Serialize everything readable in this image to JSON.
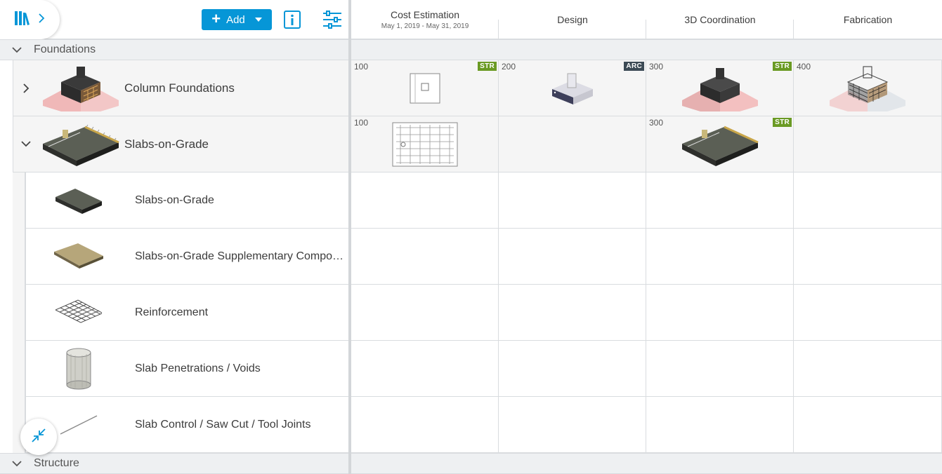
{
  "toolbar": {
    "library_icon": "library-books-icon",
    "add_label": "Add",
    "info_icon": "info-icon",
    "filter_icon": "sliders-icon"
  },
  "groups": {
    "foundations": "Foundations",
    "structure": "Structure"
  },
  "rows": {
    "column_foundations": "Column Foundations",
    "slabs_on_grade": "Slabs-on-Grade"
  },
  "subrows": [
    "Slabs-on-Grade",
    "Slabs-on-Grade Supplementary Components",
    "Reinforcement",
    "Slab Penetrations / Voids",
    "Slab Control / Saw Cut / Tool Joints"
  ],
  "columns": [
    {
      "title": "Cost Estimation",
      "dates": "May 1, 2019 - May 31, 2019"
    },
    {
      "title": "Design",
      "dates": ""
    },
    {
      "title": "3D Coordination",
      "dates": ""
    },
    {
      "title": "Fabrication",
      "dates": ""
    }
  ],
  "cells": {
    "cf_cost": {
      "num": "100",
      "tag": "STR"
    },
    "cf_design": {
      "num": "200",
      "tag": "ARC"
    },
    "cf_coord": {
      "num": "300",
      "tag": "STR"
    },
    "cf_fab": {
      "num": "400",
      "tag": ""
    },
    "sog_cost": {
      "num": "100",
      "tag": ""
    },
    "sog_coord": {
      "num": "300",
      "tag": "STR"
    }
  },
  "colors": {
    "accent": "#0696d7",
    "str_tag": "#6a9a23",
    "arc_tag": "#3c4a55",
    "band": "#eef0f2"
  },
  "fab_icon": "collapse-arrows-icon"
}
